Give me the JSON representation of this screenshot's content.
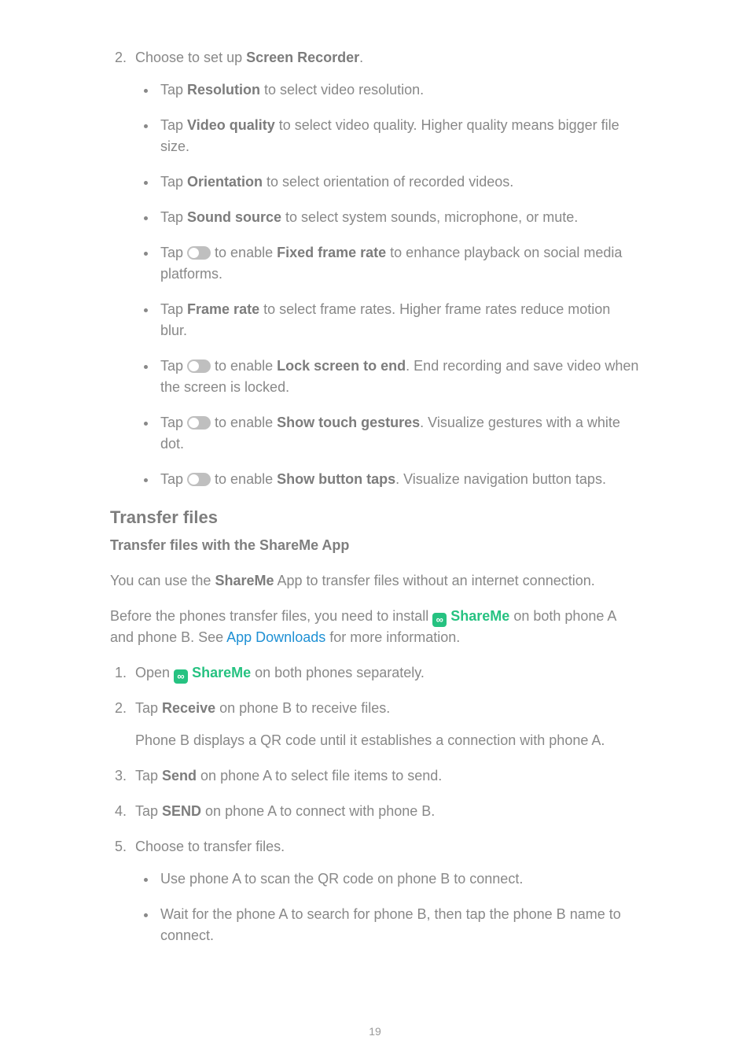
{
  "screenRecorder": {
    "step2_intro": "Choose to set up ",
    "step2_bold": "Screen Recorder",
    "step2_tail": ".",
    "items": [
      {
        "pre": "Tap ",
        "bold": "Resolution",
        "post": " to select video resolution."
      },
      {
        "pre": "Tap ",
        "bold": "Video quality",
        "post": " to select video quality. Higher quality means bigger file size."
      },
      {
        "pre": "Tap ",
        "bold": "Orientation",
        "post": " to select orientation of recorded videos."
      },
      {
        "pre": "Tap ",
        "bold": "Sound source",
        "post": " to select system sounds, microphone, or mute."
      },
      {
        "pre": "Tap ",
        "toggle": true,
        "mid": " to enable ",
        "bold": "Fixed frame rate",
        "post": " to enhance playback on social media platforms."
      },
      {
        "pre": "Tap ",
        "bold": "Frame rate",
        "post": " to select frame rates. Higher frame rates reduce motion blur."
      },
      {
        "pre": "Tap ",
        "toggle": true,
        "mid": " to enable ",
        "bold": "Lock screen to end",
        "post": ". End recording and save video when the screen is locked."
      },
      {
        "pre": "Tap ",
        "toggle": true,
        "mid": " to enable ",
        "bold": "Show touch gestures",
        "post": ". Visualize gestures with a white dot."
      },
      {
        "pre": "Tap ",
        "toggle": true,
        "mid": " to enable ",
        "bold": "Show button taps",
        "post": ". Visualize navigation button taps."
      }
    ]
  },
  "transfer": {
    "heading": "Transfer files",
    "subheading": "Transfer files with the ShareMe App",
    "intro_pre": "You can use the ",
    "intro_bold": "ShareMe",
    "intro_post": " App to transfer files without an internet connection.",
    "before_pre": "Before the phones transfer files, you need to install ",
    "shareme_label": "ShareMe",
    "before_mid": " on both phone A and phone B. See ",
    "link": "App Downloads",
    "before_post": " for more information.",
    "steps": {
      "s1_pre": "Open ",
      "s1_post": " on both phones separately.",
      "s2_pre": "Tap ",
      "s2_bold": "Receive",
      "s2_post": " on phone B to receive files.",
      "s2_note": "Phone B displays a QR code until it establishes a connection with phone A.",
      "s3_pre": "Tap ",
      "s3_bold": "Send",
      "s3_post": " on phone A to select file items to send.",
      "s4_pre": "Tap ",
      "s4_bold": "SEND",
      "s4_post": " on phone A to connect with phone B.",
      "s5": "Choose to transfer files.",
      "s5_opt1": "Use phone A to scan the QR code on phone B to connect.",
      "s5_opt2": "Wait for the phone A to search for phone B, then tap the phone B name to connect."
    }
  },
  "pageNumber": "19"
}
